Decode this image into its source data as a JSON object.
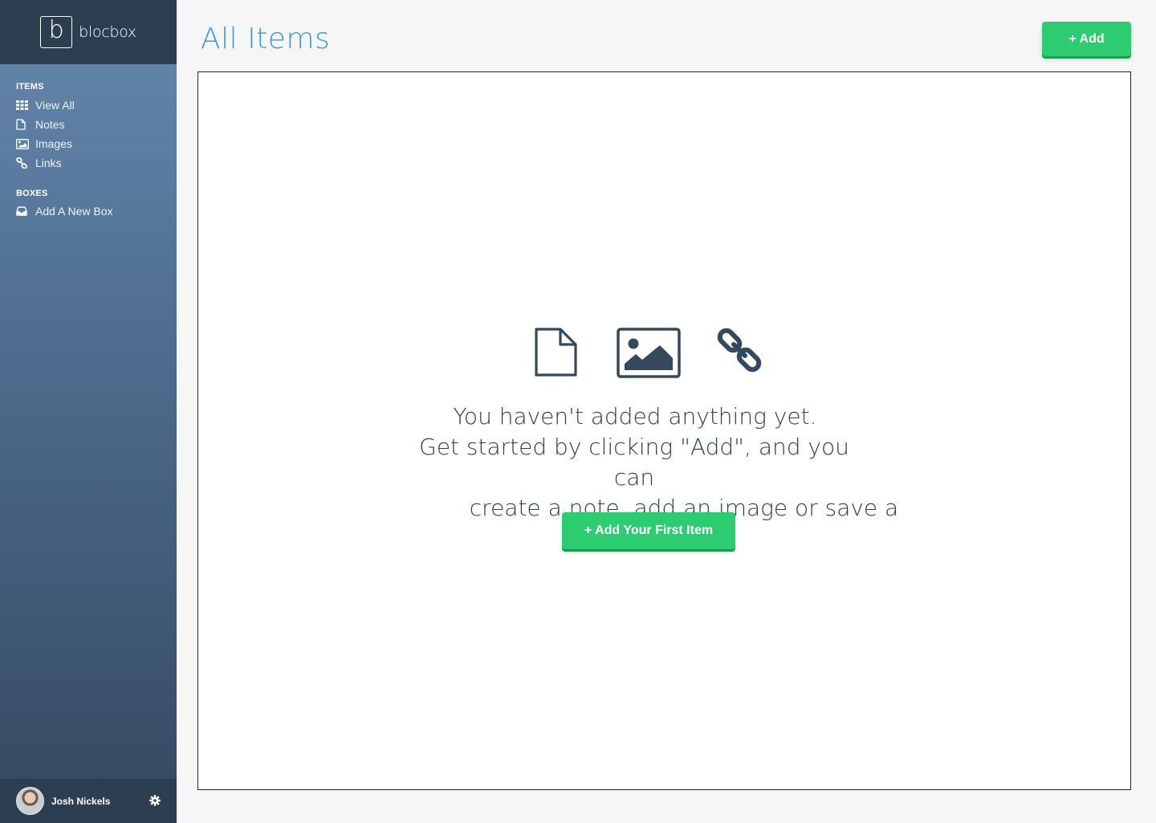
{
  "app": {
    "logo_letter": "b",
    "logo_text": "blocbox"
  },
  "sidebar": {
    "items_heading": "ITEMS",
    "items": [
      {
        "label": "View All",
        "icon": "grid-icon"
      },
      {
        "label": "Notes",
        "icon": "document-icon"
      },
      {
        "label": "Images",
        "icon": "image-icon"
      },
      {
        "label": "Links",
        "icon": "link-icon"
      }
    ],
    "boxes_heading": "BOXES",
    "boxes": [
      {
        "label": "Add A New Box",
        "icon": "inbox-icon"
      }
    ]
  },
  "user": {
    "name": "Josh Nickels",
    "settings_icon": "gear-icon"
  },
  "header": {
    "title": "All Items",
    "add_label": "+ Add"
  },
  "empty_state": {
    "icons": [
      "document-icon",
      "image-icon",
      "link-icon"
    ],
    "line1": "You haven't added anything yet.",
    "line2": "Get started by clicking \"Add\", and you can",
    "line3": "create a note, add an image or save a link.",
    "button_label": "+ Add Your First Item"
  },
  "colors": {
    "accent_blue": "#3a9ad9",
    "green": "#2ecc71",
    "sidebar_dark": "#2c3e50",
    "icon_dark": "#34495e"
  }
}
